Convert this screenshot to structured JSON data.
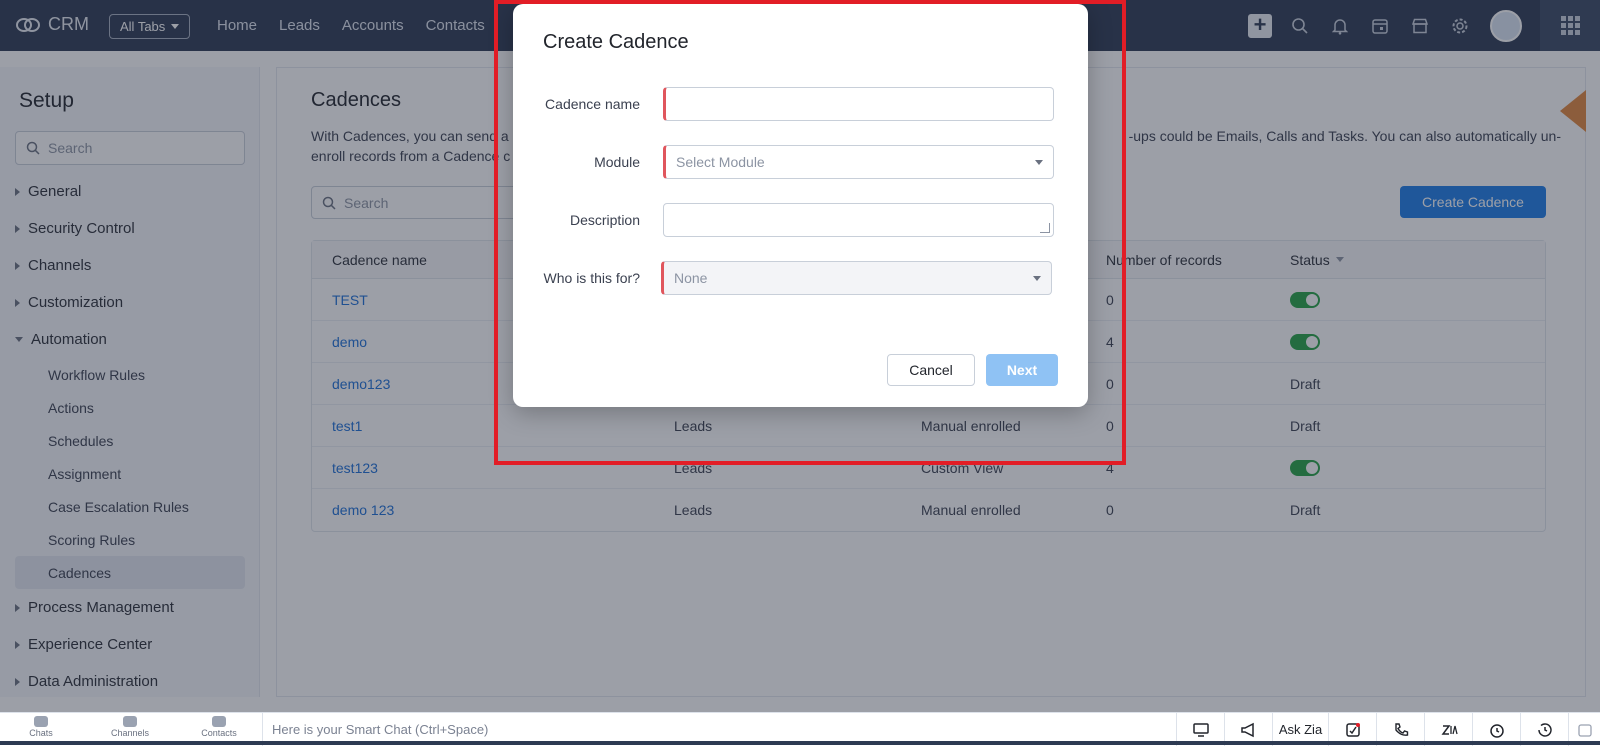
{
  "header": {
    "brand": "CRM",
    "all_tabs": "All Tabs",
    "nav": [
      "Home",
      "Leads",
      "Accounts",
      "Contacts"
    ],
    "icons": [
      "plus-icon",
      "search-icon",
      "bell-icon",
      "calendar-icon",
      "marketplace-icon",
      "gear-icon",
      "avatar",
      "apps-grid-icon"
    ]
  },
  "sidebar": {
    "title": "Setup",
    "search_placeholder": "Search",
    "sections": [
      {
        "label": "General",
        "expanded": false
      },
      {
        "label": "Security Control",
        "expanded": false
      },
      {
        "label": "Channels",
        "expanded": false
      },
      {
        "label": "Customization",
        "expanded": false
      },
      {
        "label": "Automation",
        "expanded": true
      },
      {
        "label": "Process Management",
        "expanded": false
      },
      {
        "label": "Experience Center",
        "expanded": false
      },
      {
        "label": "Data Administration",
        "expanded": false
      }
    ],
    "automation_items": [
      "Workflow Rules",
      "Actions",
      "Schedules",
      "Assignment",
      "Case Escalation Rules",
      "Scoring Rules",
      "Cadences"
    ],
    "active_item": "Cadences"
  },
  "main": {
    "title": "Cadences",
    "desc_start": "With Cadences, you can send a",
    "desc_end": "-ups could be Emails, Calls and Tasks. You can also automatically un-",
    "desc_line2": "enroll records from a Cadence c",
    "search_placeholder": "Search",
    "create_button": "Create Cadence",
    "table": {
      "headers": [
        "Cadence name",
        "",
        "",
        "Number of records",
        "Status"
      ],
      "rows": [
        {
          "name": "TEST",
          "module": "",
          "type": "",
          "records": "0",
          "status": "toggle-on"
        },
        {
          "name": "demo",
          "module": "",
          "type": "",
          "records": "4",
          "status": "toggle-on"
        },
        {
          "name": "demo123",
          "module": "",
          "type": "",
          "records": "0",
          "status": "Draft"
        },
        {
          "name": "test1",
          "module": "Leads",
          "type": "Manual enrolled",
          "records": "0",
          "status": "Draft"
        },
        {
          "name": "test123",
          "module": "Leads",
          "type": "Custom View",
          "records": "4",
          "status": "toggle-on"
        },
        {
          "name": "demo 123",
          "module": "Leads",
          "type": "Manual enrolled",
          "records": "0",
          "status": "Draft"
        }
      ]
    }
  },
  "modal": {
    "title": "Create Cadence",
    "fields": {
      "name_label": "Cadence name",
      "name_value": "",
      "module_label": "Module",
      "module_placeholder": "Select Module",
      "description_label": "Description",
      "description_value": "",
      "audience_label": "Who is this for?",
      "audience_value": "None"
    },
    "cancel": "Cancel",
    "next": "Next"
  },
  "bottombar": {
    "items": [
      "Chats",
      "Channels",
      "Contacts"
    ],
    "smart_chat": "Here is your Smart Chat (Ctrl+Space)",
    "ask_zia": "Ask Zia"
  },
  "colors": {
    "header_bg": "#2d3a52",
    "accent": "#1d7de8",
    "toggle_on": "#25a244",
    "highlight_border": "#e21d26"
  }
}
